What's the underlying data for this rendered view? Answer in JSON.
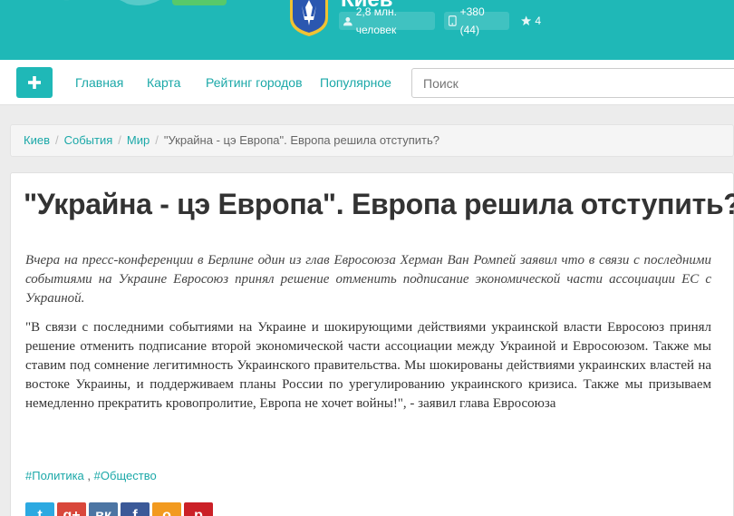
{
  "header": {
    "city_title": "Киев",
    "stats": {
      "population": "2,8 млн. человек",
      "phone_code": "+380 (44)",
      "favorites": "4"
    },
    "icons": [
      "user-icon",
      "phone-icon",
      "star-icon"
    ]
  },
  "nav": {
    "add_label": "+",
    "links": [
      "Главная",
      "Карта",
      "Рейтинг городов",
      "Популярное"
    ],
    "search_placeholder": "Поиск"
  },
  "breadcrumb": {
    "items": [
      "Киев",
      "События",
      "Мир"
    ],
    "current": "\"Украйна - цэ Европа\". Европа решила отступить?"
  },
  "article": {
    "title": "\"Украйна - цэ Европа\". Европа решила отступить?",
    "lead": "Вчера на пресс-конференции в Берлине один из глав Евросоюза Херман Ван Ромпей заявил что в связи с последними событиями на Украине Евросоюз принял решение отменить подписание экономической части ассоциации ЕС с Украиной.",
    "quote": "\"В связи с последними событиями на Украине и шокирующими действиями украинской власти Евросоюз принял решение отменить подписание второй экономической части ассоциации между Украиной и Евросоюзом. Также мы ставим под сомнение легитимность Украинского правительства. Мы шокированы действиями украинских властей на востоке Украины, и поддерживаем планы России по урегулированию украинского кризиса. Также мы призываем немедленно прекратить кровопролитие, Европа не хочет войны!\", - заявил глава Евросоюза",
    "tags": [
      "#Политика",
      "#Общество"
    ],
    "tag_separator": ","
  },
  "share": {
    "buttons": [
      {
        "name": "twitter",
        "glyph": "t",
        "color": "#2ca9e1"
      },
      {
        "name": "google-plus",
        "glyph": "g+",
        "color": "#d9473b"
      },
      {
        "name": "vkontakte",
        "glyph": "вк",
        "color": "#4c75a3"
      },
      {
        "name": "facebook",
        "glyph": "f",
        "color": "#3b5998"
      },
      {
        "name": "odnoklassniki",
        "glyph": "о",
        "color": "#f29a1f"
      },
      {
        "name": "pinterest",
        "glyph": "p",
        "color": "#cb2027"
      }
    ]
  },
  "colors": {
    "brand_teal": "#1fb8b7",
    "link_teal": "#1ba8a8"
  }
}
